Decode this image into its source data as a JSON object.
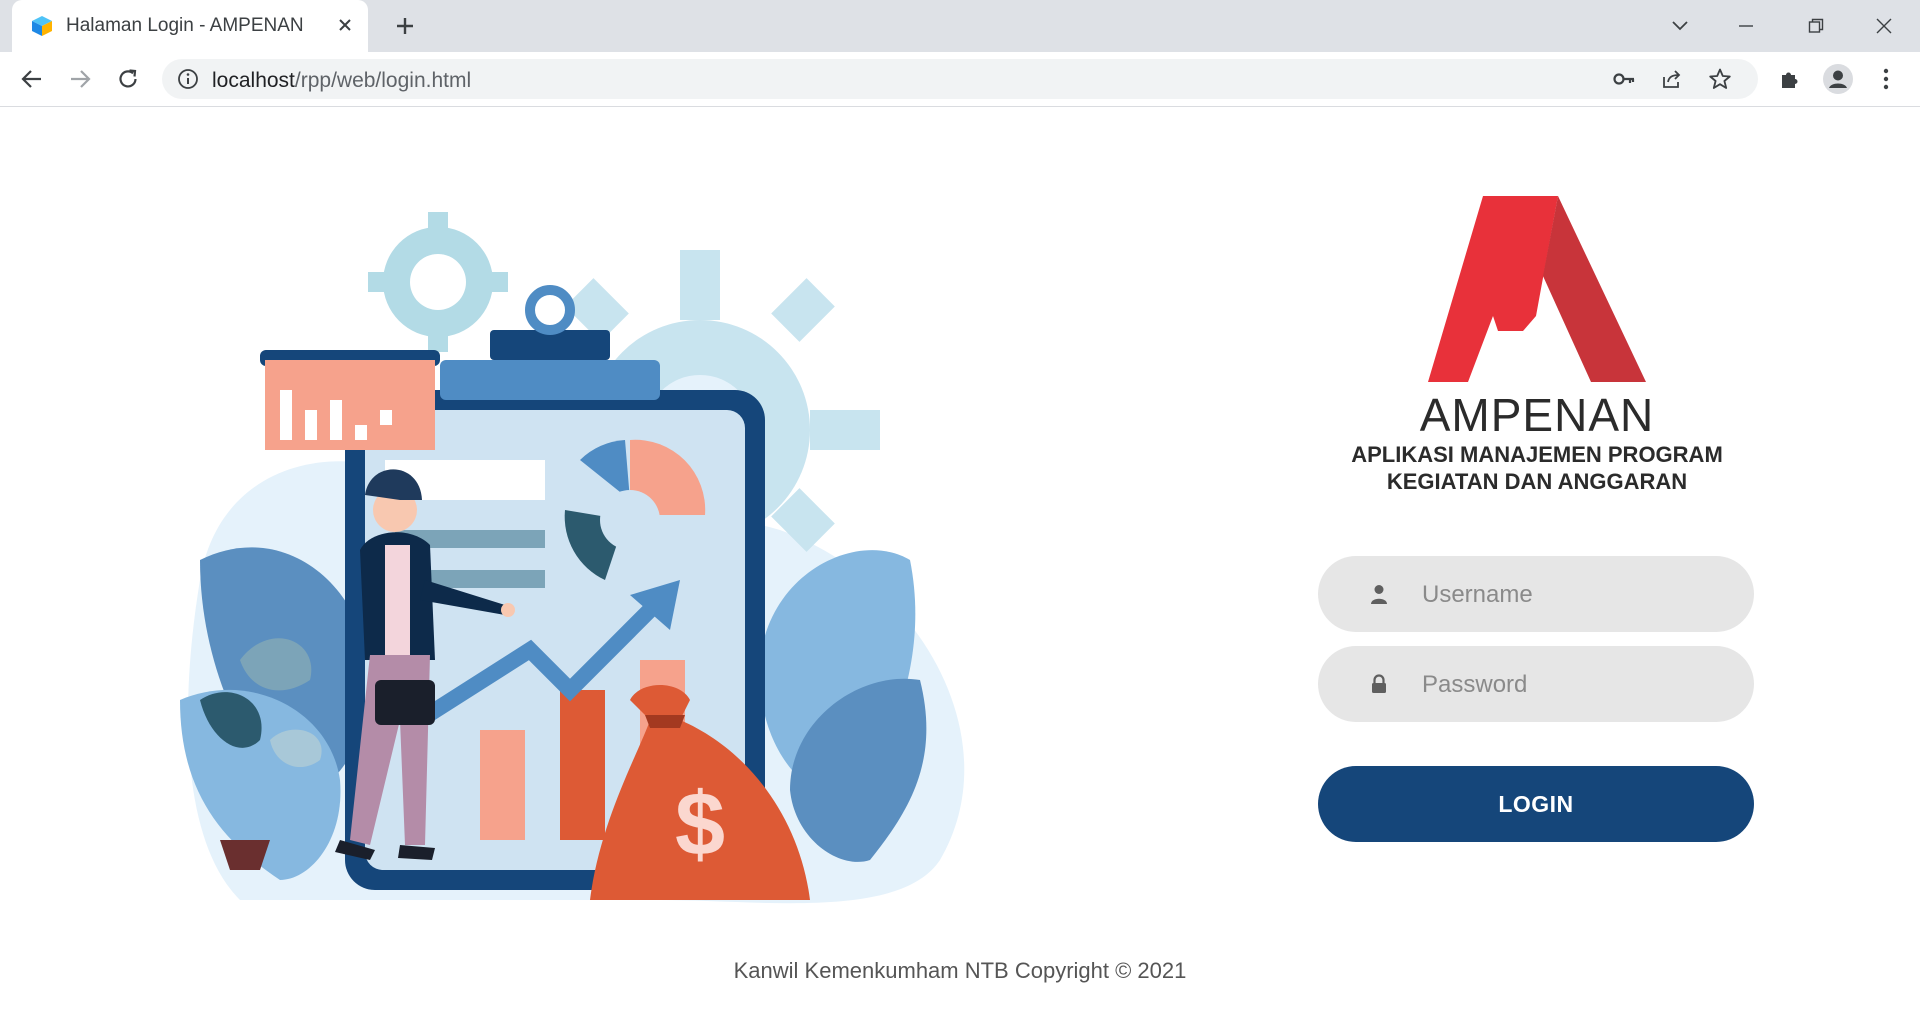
{
  "browser": {
    "tab_title": "Halaman Login - AMPENAN",
    "url_host": "localhost",
    "url_path": "/rpp/web/login.html"
  },
  "brand": {
    "name": "AMPENAN",
    "subtitle_line1": "APLIKASI MANAJEMEN PROGRAM",
    "subtitle_line2": "KEGIATAN DAN ANGGARAN"
  },
  "login_form": {
    "username_placeholder": "Username",
    "password_placeholder": "Password",
    "login_label": "LOGIN"
  },
  "footer": {
    "text": "Kanwil Kemenkumham NTB Copyright © 2021"
  },
  "colors": {
    "primary": "#15467a",
    "logo_red": "#e8313a",
    "field_bg": "#e6e6e6"
  }
}
